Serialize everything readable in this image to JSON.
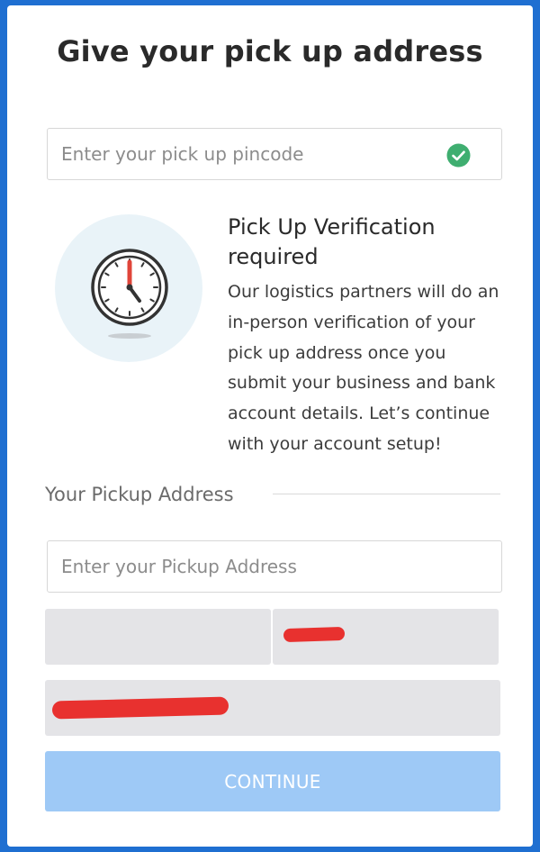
{
  "page": {
    "title": "Give your pick up address"
  },
  "pincode": {
    "placeholder": "Enter your pick up pincode",
    "value": "",
    "status_icon": "check-circle-icon"
  },
  "verification": {
    "icon": "clock-icon",
    "title": "Pick Up Verification required",
    "body": "Our logistics partners will do an in-person verification of your pick up address once you submit your business and bank account details. Let’s continue with your account setup!"
  },
  "address_section": {
    "label": "Your Pickup Address",
    "address_placeholder": "Enter your Pickup Address",
    "address_value": ""
  },
  "actions": {
    "continue_label": "CONTINUE"
  },
  "colors": {
    "background": "#1f6fd1",
    "check": "#3fae70",
    "button_disabled": "#9ec9f6",
    "readonly_field": "#e4e4e7",
    "redaction": "#e8312f",
    "clock_hand": "#e0453a"
  }
}
